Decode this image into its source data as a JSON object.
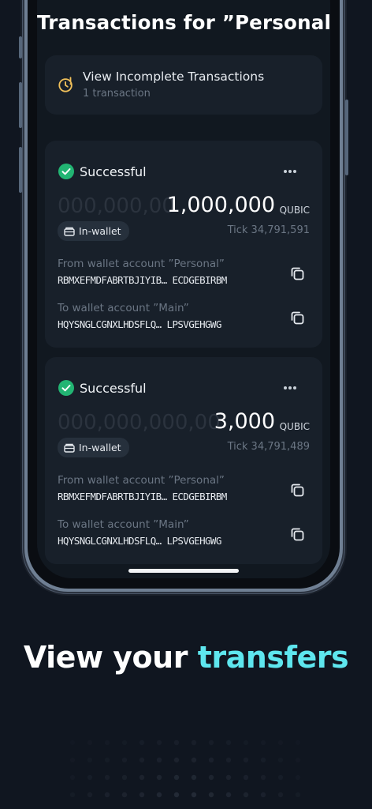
{
  "screen": {
    "title": "Transactions for ”Personal”",
    "incomplete": {
      "title": "View Incomplete Transactions",
      "subtitle": "1 transaction"
    },
    "transactions": [
      {
        "status": "Successful",
        "amount_ghost": "000,000,00",
        "amount": "1,000,000",
        "unit": "QUBIC",
        "badge": "In-wallet",
        "tick": "Tick 34,791,591",
        "from_label": "From wallet account ”Personal”",
        "from_address": "RBMXEFMDFABRTBJIYIB… ECDGEBIRBM",
        "to_label": "To wallet account ”Main”",
        "to_address": "HQYSNGLCGNXLHDSFLQ… LPSVGEHGWG"
      },
      {
        "status": "Successful",
        "amount_ghost": "000,000,000,00",
        "amount": "3,000",
        "unit": "QUBIC",
        "badge": "In-wallet",
        "tick": "Tick 34,791,489",
        "from_label": "From wallet account ”Personal”",
        "from_address": "RBMXEFMDFABRTBJIYIB… ECDGEBIRBM",
        "to_label": "To wallet account ”Main”",
        "to_address": "HQYSNGLCGNXLHDSFLQ… LPSVGEHGWG"
      }
    ]
  },
  "tagline": {
    "prefix": "View your",
    "accent": "transfers"
  },
  "icons": {
    "incomplete": "clock-warning-icon",
    "status": "check-circle-icon",
    "more": "more-horizontal-icon",
    "badge": "wallet-icon",
    "copy": "copy-icon"
  },
  "colors": {
    "background": "#101620",
    "card": "#18202a",
    "success": "#22b573",
    "warning": "#f0c05a",
    "accent": "#5ee6ee"
  }
}
